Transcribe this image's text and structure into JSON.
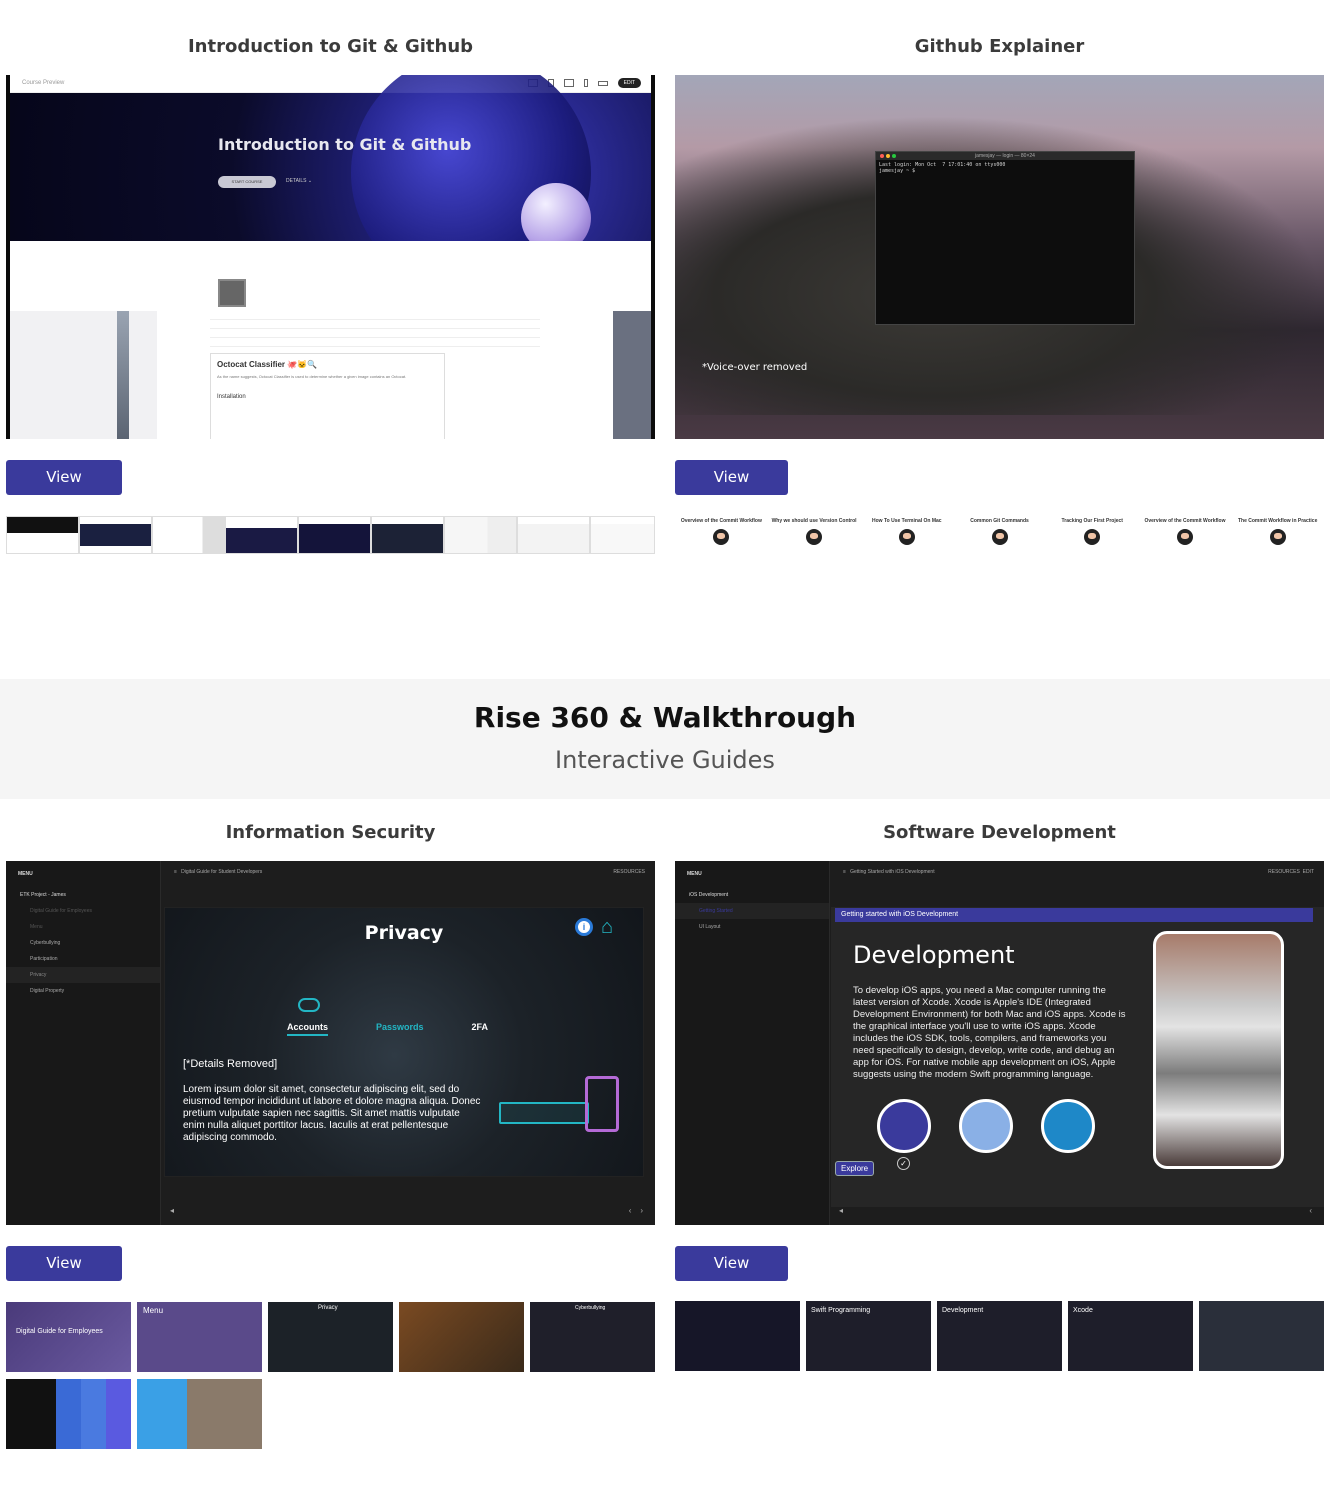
{
  "cards": {
    "git": {
      "title": "Introduction to Git & Github",
      "view_label": "View",
      "preview": {
        "topbar_label": "Course Preview",
        "edit_label": "EDIT",
        "hero_title": "Introduction to Git & Github",
        "start_label": "START COURSE",
        "details_label": "DETAILS",
        "readme_title": "Octocat Classifier 🐙🐱🔍",
        "readme_text": "As the name suggests, Octocat Classifier is used to determine whether a given image contains an Octocat.",
        "install_label": "Installation"
      }
    },
    "github": {
      "title": "Github Explainer",
      "view_label": "View",
      "terminal_title": "jamesjay — login — 80×24",
      "terminal_text": "Last login: Mon Oct  7 17:01:40 on ttys000\njamesjay ~ $ ",
      "voice_note": "*Voice-over removed",
      "chapters": [
        "Overview of the Commit Workflow",
        "Why we should use Version Control",
        "How To Use Terminal On Mac",
        "Common Git Commands",
        "Tracking Our First Project",
        "Overview of the Commit Workflow",
        "The Commit Workflow in Practice"
      ]
    },
    "infosec": {
      "title": "Information Security",
      "view_label": "View",
      "menu_label": "MENU",
      "topbar_title": "Digital Guide for Student Developers",
      "resources_label": "RESOURCES",
      "side_items": [
        "ETK Project - James",
        "Digital Guide for Employees",
        "Menu",
        "Cyberbullying",
        "Participation",
        "Privacy",
        "Digital Property"
      ],
      "slide": {
        "title": "Privacy",
        "tabs": [
          "Accounts",
          "Passwords",
          "2FA"
        ],
        "details": "[*Details Removed]",
        "body": "Lorem ipsum dolor sit amet, consectetur adipiscing elit, sed do eiusmod tempor incididunt ut labore et dolore magna aliqua. Donec pretium vulputate sapien nec sagittis. Sit amet mattis vulputate enim nulla aliquet porttitor lacus. Iaculis at erat pellentesque adipiscing commodo."
      }
    },
    "software": {
      "title": "Software Development",
      "view_label": "View",
      "menu_label": "MENU",
      "topbar_title": "Getting Started with iOS Development",
      "resources_label": "RESOURCES",
      "edit_label": "EDIT",
      "side_items": [
        "iOS Development",
        "Getting Started",
        "UI Layout"
      ],
      "banner": "Getting started with iOS Development",
      "slide_title": "Development",
      "slide_body": "To develop iOS apps, you need a Mac computer running the latest version of Xcode. Xcode is Apple's IDE (Integrated Development Environment) for both Mac and iOS apps. Xcode is the graphical interface you'll use to write iOS apps. Xcode includes the iOS SDK, tools, compilers, and frameworks you need specifically to design, develop, write code, and debug an app for iOS. For native mobile app development on iOS, Apple suggests using the modern Swift programming language.",
      "explore_label": "Explore",
      "thumbs": [
        "",
        "Swift Programming",
        "Development",
        "Xcode",
        ""
      ]
    }
  },
  "section": {
    "title": "Rise 360 & Walkthrough",
    "subtitle": "Interactive Guides"
  },
  "infosec_thumbs": [
    "Digital Guide for Employees",
    "Menu",
    "Privacy",
    "",
    "Cyberbullying",
    "",
    ""
  ],
  "colors": {
    "accent": "#3a3a9c",
    "teal": "#23b6c4"
  }
}
